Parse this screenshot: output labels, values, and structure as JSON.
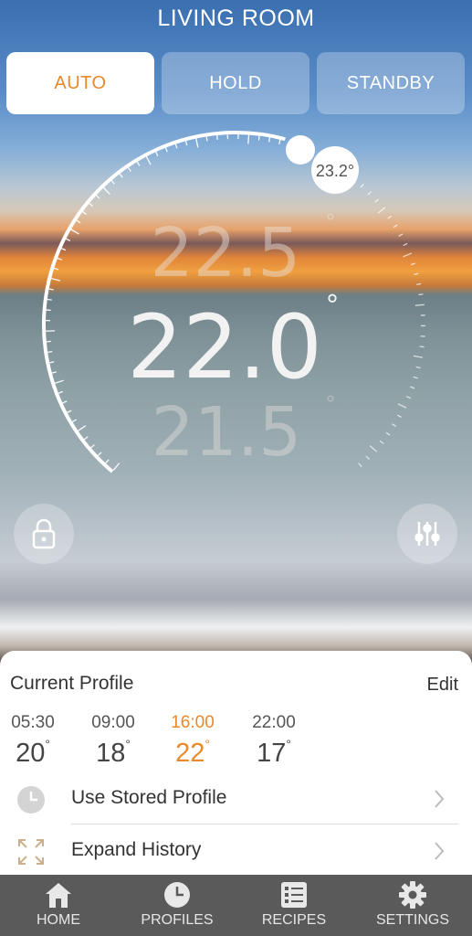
{
  "header": {
    "title": "LIVING ROOM"
  },
  "modes": [
    {
      "label": "AUTO",
      "active": true
    },
    {
      "label": "HOLD",
      "active": false
    },
    {
      "label": "STANDBY",
      "active": false
    }
  ],
  "dial": {
    "setpoint_above": "22.5",
    "setpoint_current": "22.0",
    "setpoint_below": "21.5",
    "degree_symbol": "°",
    "current_temp_badge": "23.2°",
    "icons": {
      "left": "lock-icon",
      "right": "sliders-icon"
    }
  },
  "profile": {
    "title": "Current Profile",
    "edit_label": "Edit",
    "schedule": [
      {
        "time": "05:30",
        "temp": "20",
        "current": false
      },
      {
        "time": "09:00",
        "temp": "18",
        "current": false
      },
      {
        "time": "16:00",
        "temp": "22",
        "current": true
      },
      {
        "time": "22:00",
        "temp": "17",
        "current": false
      }
    ],
    "degree": "°",
    "rows": [
      {
        "label": "Use Stored Profile",
        "icon": "clock-icon"
      },
      {
        "label": "Expand History",
        "icon": "expand-icon"
      }
    ]
  },
  "nav": [
    {
      "label": "HOME",
      "icon": "home-icon"
    },
    {
      "label": "PROFILES",
      "icon": "clock-icon"
    },
    {
      "label": "RECIPES",
      "icon": "list-icon"
    },
    {
      "label": "SETTINGS",
      "icon": "gear-icon"
    }
  ],
  "colors": {
    "accent": "#e8892b",
    "nav_bg": "#5a5a5a",
    "card_bg": "#ffffff"
  }
}
